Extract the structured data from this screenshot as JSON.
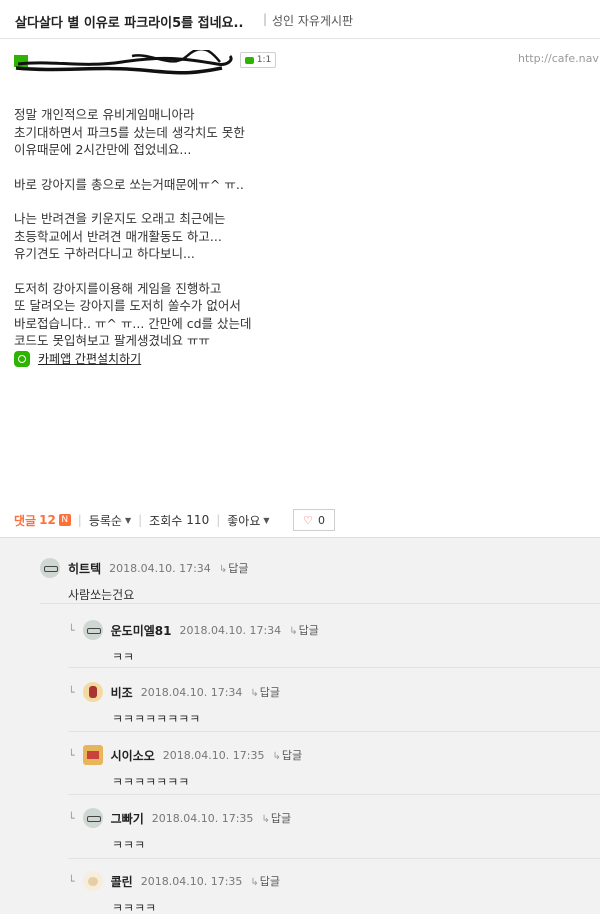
{
  "post": {
    "title": "살다살다 별 이유로 파크라이5를 접네요..",
    "separator": "|",
    "board": "성인 자유게시판",
    "chat_count": "1:1",
    "cafe_url": "http://cafe.nav",
    "paragraphs": [
      [
        "정말 개인적으로 유비게임매니아라",
        "초기대하면서 파크5를 샀는데 생각치도 못한",
        "이유때문에 2시간만에 접었네요..."
      ],
      [
        "바로 강아지를 총으로 쏘는거때문에ㅠ^ ㅠ.."
      ],
      [
        "나는 반려견을 키운지도 오래고 최근에는",
        "초등학교에서 반려견 매개활동도 하고...",
        "유기견도 구하러다니고 하다보니..."
      ],
      [
        "도저히 강아지를이용해 게임을 진행하고",
        "또 달려오는 강아지를 도저히 쏠수가 없어서",
        "바로접습니다.. ㅠ^ ㅠ... 간만에 cd를 샀는데",
        "코드도 못입혀보고 팔게생겼네요 ㅠㅠ"
      ]
    ],
    "app_link": "카페앱 간편설치하기"
  },
  "comment_bar": {
    "label": "댓글",
    "count": "12",
    "count_badge": "N",
    "sort": "등록순",
    "views_label": "조회수",
    "views": "110",
    "like_label": "좋아요",
    "like_count": "0"
  },
  "reply_label": "답글",
  "comments": [
    {
      "nick": "히트텍",
      "date": "2018.04.10. 17:34",
      "text": "사람쏘는건요",
      "avatar": "glasses-avatar"
    },
    {
      "nick": "운도미엘81",
      "date": "2018.04.10. 17:34",
      "text": "ㅋㅋ",
      "avatar": "glasses-avatar"
    },
    {
      "nick": "비조",
      "date": "2018.04.10. 17:34",
      "text": "ㅋㅋㅋㅋㅋㅋㅋㅋ",
      "avatar": "character-avatar"
    },
    {
      "nick": "시이소오",
      "date": "2018.04.10. 17:35",
      "text": "ㅋㅋㅋㅋㅋㅋㅋ",
      "avatar": "box-avatar"
    },
    {
      "nick": "그빠기",
      "date": "2018.04.10. 17:35",
      "text": "ㅋㅋㅋ",
      "avatar": "glasses-avatar"
    },
    {
      "nick": "콜린",
      "date": "2018.04.10. 17:35",
      "text": "ㅋㅋㅋㅋ",
      "avatar": "hand-avatar"
    }
  ],
  "colors": {
    "accent_green": "#2db400",
    "badge_orange": "#ff6f3a",
    "heart_red": "#ff4e4e",
    "comment_bg": "#f2f2f2"
  }
}
